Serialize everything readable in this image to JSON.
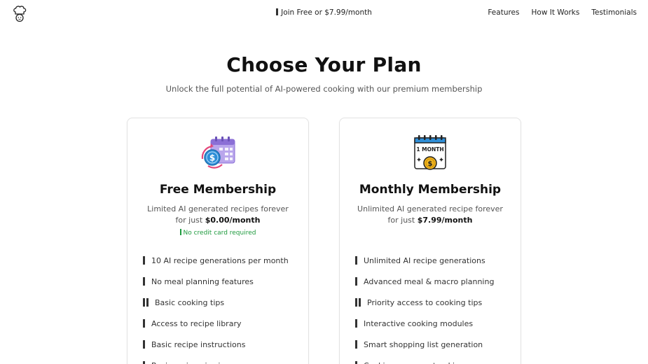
{
  "header": {
    "logo_icon": "chef-hat-icon",
    "promo_text": "Join Free or $7.99/month",
    "nav": [
      "Features",
      "How It Works",
      "Testimonials"
    ]
  },
  "hero": {
    "title": "Choose Your Plan",
    "subtitle": "Unlock the full potential of AI-powered cooking with our premium membership"
  },
  "plans": [
    {
      "icon": "calendar-dollar-icon",
      "title": "Free Membership",
      "desc_prefix": "Limited AI generated recipes forever for just",
      "price": "$0.00/month",
      "note": "No credit card required",
      "features": [
        {
          "text": "10 AI recipe generations per month",
          "marks": 1
        },
        {
          "text": "No meal planning features",
          "marks": 1
        },
        {
          "text": "Basic cooking tips",
          "marks": 2
        },
        {
          "text": "Access to recipe library",
          "marks": 1
        },
        {
          "text": "Basic recipe instructions",
          "marks": 1
        },
        {
          "text": "Basic recipe viewing",
          "marks": 1
        }
      ]
    },
    {
      "icon": "one-month-calendar-icon",
      "icon_label": "1 MONTH",
      "title": "Monthly Membership",
      "desc_prefix": "Unlimited AI generated recipe forever for just",
      "price": "$7.99/month",
      "features": [
        {
          "text": "Unlimited AI recipe generations",
          "marks": 1
        },
        {
          "text": "Advanced meal & macro planning",
          "marks": 1
        },
        {
          "text": "Priority access to cooking tips",
          "marks": 2
        },
        {
          "text": "Interactive cooking modules",
          "marks": 1
        },
        {
          "text": "Smart shopping list generation",
          "marks": 1
        },
        {
          "text": "Cooking progress tracking",
          "marks": 1
        }
      ]
    }
  ],
  "colors": {
    "accent_green": "#1e9a3e",
    "calendar_purple": "#8b6fd6",
    "coin_blue": "#2f8fd8",
    "coin_gold": "#f2b61f"
  }
}
